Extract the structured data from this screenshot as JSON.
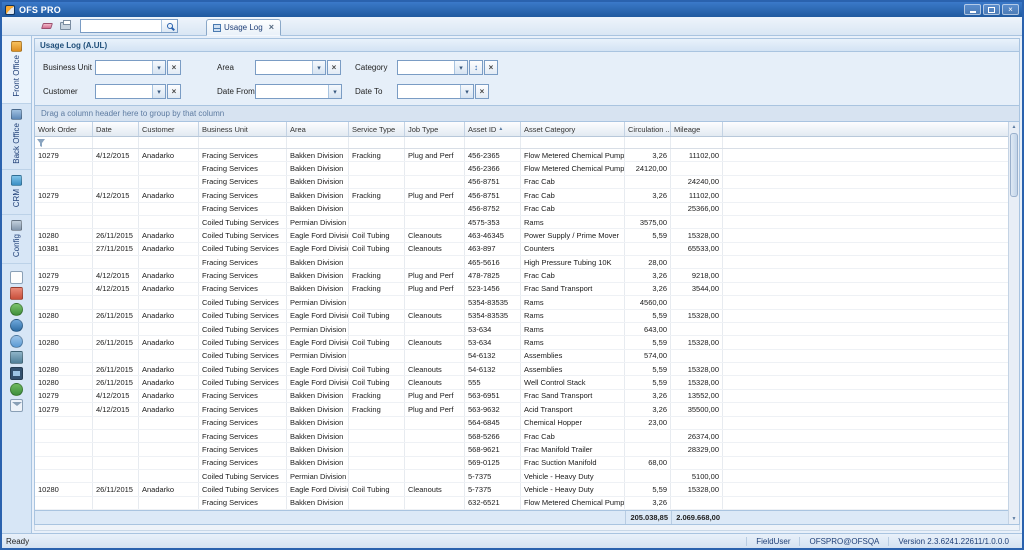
{
  "window": {
    "title": "OFS PRO"
  },
  "icons": {
    "close": "×",
    "dropdown": "▾",
    "spin": "↕",
    "sort_asc": "▲",
    "scroll_up": "▲",
    "scroll_down": "▼"
  },
  "toolbar": {
    "search_value": ""
  },
  "tab": {
    "label": "Usage Log"
  },
  "panel": {
    "title": "Usage Log (A.UL)"
  },
  "filters": {
    "business_unit": {
      "label": "Business Unit",
      "value": ""
    },
    "area": {
      "label": "Area",
      "value": ""
    },
    "category": {
      "label": "Category",
      "value": ""
    },
    "customer": {
      "label": "Customer",
      "value": ""
    },
    "date_from": {
      "label": "Date From",
      "value": ""
    },
    "date_to": {
      "label": "Date To",
      "value": ""
    }
  },
  "sidebar": {
    "tabs": [
      "Front Office",
      "Back Office",
      "CRM",
      "Config"
    ]
  },
  "grid": {
    "group_hint": "Drag a column header here to group by that column",
    "columns": [
      "Work Order",
      "Date",
      "Customer",
      "Business Unit",
      "Area",
      "Service Type",
      "Job Type",
      "Asset ID",
      "Asset Category",
      "Circulation ...",
      "Mileage"
    ],
    "sorted_column": "Asset ID",
    "rows": [
      [
        "10279",
        "4/12/2015",
        "Anadarko",
        "Fracing Services",
        "Bakken Division",
        "Fracking",
        "Plug and Perf",
        "456-2365",
        "Flow Metered Chemical Pump",
        "3,26",
        "11102,00"
      ],
      [
        "",
        "",
        "",
        "Fracing Services",
        "Bakken Division",
        "",
        "",
        "456-2366",
        "Flow Metered Chemical Pump",
        "24120,00",
        ""
      ],
      [
        "",
        "",
        "",
        "Fracing Services",
        "Bakken Division",
        "",
        "",
        "456-8751",
        "Frac Cab",
        "",
        "24240,00"
      ],
      [
        "10279",
        "4/12/2015",
        "Anadarko",
        "Fracing Services",
        "Bakken Division",
        "Fracking",
        "Plug and Perf",
        "456-8751",
        "Frac Cab",
        "3,26",
        "11102,00"
      ],
      [
        "",
        "",
        "",
        "Fracing Services",
        "Bakken Division",
        "",
        "",
        "456-8752",
        "Frac Cab",
        "",
        "25366,00"
      ],
      [
        "",
        "",
        "",
        "Coiled Tubing Services",
        "Permian Division",
        "",
        "",
        "4575-353",
        "Rams",
        "3575,00",
        ""
      ],
      [
        "10280",
        "26/11/2015",
        "Anadarko",
        "Coiled Tubing Services",
        "Eagle Ford Division",
        "Coil Tubing",
        "Cleanouts",
        "463-46345",
        "Power Supply / Prime Mover",
        "5,59",
        "15328,00"
      ],
      [
        "10381",
        "27/11/2015",
        "Anadarko",
        "Coiled Tubing Services",
        "Eagle Ford Division",
        "Coil Tubing",
        "Cleanouts",
        "463-897",
        "Counters",
        "",
        "65533,00"
      ],
      [
        "",
        "",
        "",
        "Fracing Services",
        "Bakken Division",
        "",
        "",
        "465-5616",
        "High Pressure Tubing 10K",
        "28,00",
        ""
      ],
      [
        "10279",
        "4/12/2015",
        "Anadarko",
        "Fracing Services",
        "Bakken Division",
        "Fracking",
        "Plug and Perf",
        "478-7825",
        "Frac Cab",
        "3,26",
        "9218,00"
      ],
      [
        "10279",
        "4/12/2015",
        "Anadarko",
        "Fracing Services",
        "Bakken Division",
        "Fracking",
        "Plug and Perf",
        "523-1456",
        "Frac Sand Transport",
        "3,26",
        "3544,00"
      ],
      [
        "",
        "",
        "",
        "Coiled Tubing Services",
        "Permian Division",
        "",
        "",
        "5354-83535",
        "Rams",
        "4560,00",
        ""
      ],
      [
        "10280",
        "26/11/2015",
        "Anadarko",
        "Coiled Tubing Services",
        "Eagle Ford Division",
        "Coil Tubing",
        "Cleanouts",
        "5354-83535",
        "Rams",
        "5,59",
        "15328,00"
      ],
      [
        "",
        "",
        "",
        "Coiled Tubing Services",
        "Permian Division",
        "",
        "",
        "53-634",
        "Rams",
        "643,00",
        ""
      ],
      [
        "10280",
        "26/11/2015",
        "Anadarko",
        "Coiled Tubing Services",
        "Eagle Ford Division",
        "Coil Tubing",
        "Cleanouts",
        "53-634",
        "Rams",
        "5,59",
        "15328,00"
      ],
      [
        "",
        "",
        "",
        "Coiled Tubing Services",
        "Permian Division",
        "",
        "",
        "54-6132",
        "Assemblies",
        "574,00",
        ""
      ],
      [
        "10280",
        "26/11/2015",
        "Anadarko",
        "Coiled Tubing Services",
        "Eagle Ford Division",
        "Coil Tubing",
        "Cleanouts",
        "54-6132",
        "Assemblies",
        "5,59",
        "15328,00"
      ],
      [
        "10280",
        "26/11/2015",
        "Anadarko",
        "Coiled Tubing Services",
        "Eagle Ford Division",
        "Coil Tubing",
        "Cleanouts",
        "555",
        "Well Control Stack",
        "5,59",
        "15328,00"
      ],
      [
        "10279",
        "4/12/2015",
        "Anadarko",
        "Fracing Services",
        "Bakken Division",
        "Fracking",
        "Plug and Perf",
        "563-6951",
        "Frac Sand Transport",
        "3,26",
        "13552,00"
      ],
      [
        "10279",
        "4/12/2015",
        "Anadarko",
        "Fracing Services",
        "Bakken Division",
        "Fracking",
        "Plug and Perf",
        "563-9632",
        "Acid Transport",
        "3,26",
        "35500,00"
      ],
      [
        "",
        "",
        "",
        "Fracing Services",
        "Bakken Division",
        "",
        "",
        "564-6845",
        "Chemical Hopper",
        "23,00",
        ""
      ],
      [
        "",
        "",
        "",
        "Fracing Services",
        "Bakken Division",
        "",
        "",
        "568-5266",
        "Frac Cab",
        "",
        "26374,00"
      ],
      [
        "",
        "",
        "",
        "Fracing Services",
        "Bakken Division",
        "",
        "",
        "568-9621",
        "Frac Manifold Trailer",
        "",
        "28329,00"
      ],
      [
        "",
        "",
        "",
        "Fracing Services",
        "Bakken Division",
        "",
        "",
        "569-0125",
        "Frac Suction Manifold",
        "68,00",
        ""
      ],
      [
        "",
        "",
        "",
        "Coiled Tubing Services",
        "Permian Division",
        "",
        "",
        "5-7375",
        "Vehicle - Heavy Duty",
        "",
        "5100,00"
      ],
      [
        "10280",
        "26/11/2015",
        "Anadarko",
        "Coiled Tubing Services",
        "Eagle Ford Division",
        "Coil Tubing",
        "Cleanouts",
        "5-7375",
        "Vehicle - Heavy Duty",
        "5,59",
        "15328,00"
      ],
      [
        "",
        "",
        "",
        "Fracing Services",
        "Bakken Division",
        "",
        "",
        "632-6521",
        "Flow Metered Chemical Pump",
        "3,26",
        ""
      ]
    ],
    "summary": {
      "circulation": "205.038,85",
      "mileage": "2.069.668,00"
    }
  },
  "statusbar": {
    "ready": "Ready",
    "user": "FieldUser",
    "server": "OFSPRO@OFSQA",
    "version": "Version 2.3.6241.22611/1.0.0.0"
  }
}
